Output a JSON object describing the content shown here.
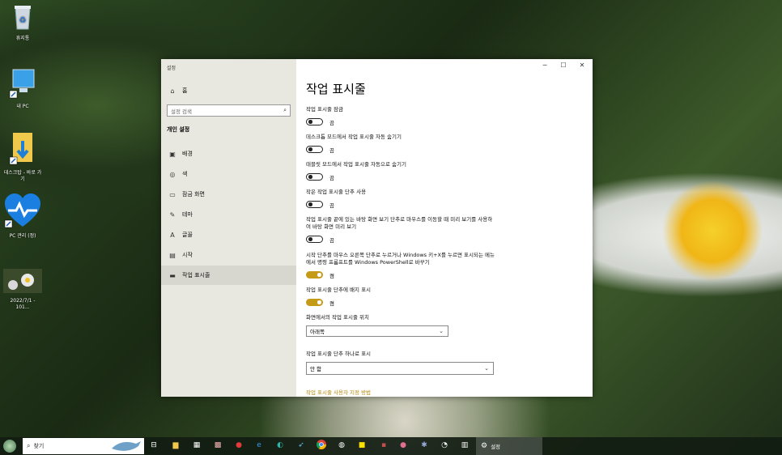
{
  "desktop": {
    "icons": [
      {
        "label": "휴지통",
        "icon": "recycle-bin-icon"
      },
      {
        "label": "내 PC",
        "icon": "computer-icon"
      },
      {
        "label": "데스크탑 - 바로 가기",
        "icon": "download-folder-icon"
      },
      {
        "label": "PC 관리 (정)",
        "icon": "heart-health-icon"
      },
      {
        "label": "2022/7/1 - 101...",
        "icon": "image-thumbnail-icon"
      }
    ]
  },
  "window": {
    "app_title": "설정",
    "controls": {
      "minimize": "─",
      "maximize": "☐",
      "close": "✕"
    }
  },
  "sidebar": {
    "home": {
      "label": "홈",
      "icon": "home-icon"
    },
    "search_placeholder": "설정 검색",
    "section_title": "개인 설정",
    "items": [
      {
        "label": "배경",
        "icon": "image-icon"
      },
      {
        "label": "색",
        "icon": "palette-icon"
      },
      {
        "label": "잠금 화면",
        "icon": "lock-screen-icon"
      },
      {
        "label": "테마",
        "icon": "theme-brush-icon"
      },
      {
        "label": "글꼴",
        "icon": "font-icon"
      },
      {
        "label": "시작",
        "icon": "start-icon"
      },
      {
        "label": "작업 표시줄",
        "icon": "taskbar-icon"
      }
    ],
    "active_index": 6
  },
  "main": {
    "title": "작업 표시줄",
    "settings": [
      {
        "label": "작업 표시줄 잠금",
        "state": "끔",
        "on": false
      },
      {
        "label": "데스크톱 모드에서 작업 표시줄 자동 숨기기",
        "state": "끔",
        "on": false
      },
      {
        "label": "태블릿 모드에서 작업 표시줄 자동으로 숨기기",
        "state": "끔",
        "on": false
      },
      {
        "label": "작은 작업 표시줄 단추 사용",
        "state": "끔",
        "on": false
      },
      {
        "label": "작업 표시줄 끝에 있는 바탕 화면 보기 단추로 마우스를 이동할 때 미리 보기를 사용하여 바탕 화면 미리 보기",
        "state": "끔",
        "on": false
      },
      {
        "label": "시작 단추를 마우스 오른쪽 단추로 누르거나 Windows 키+X를 누르면 표시되는 메뉴에서 명령 프롬프트를 Windows PowerShell로 바꾸기",
        "state": "켬",
        "on": true
      },
      {
        "label": "작업 표시줄 단추에 배지 표시",
        "state": "켬",
        "on": true
      }
    ],
    "location": {
      "label": "화면에서의 작업 표시줄 위치",
      "value": "아래쪽"
    },
    "combine": {
      "label": "작업 표시줄 단추 하나로 표시",
      "value": "안 함"
    },
    "link": "작업 표시줄 사용자 지정 방법"
  },
  "taskbar": {
    "search_placeholder": "찾기",
    "active_app": "설정",
    "pinned": [
      "task-view-icon",
      "file-explorer-icon",
      "calendar-icon",
      "photo-app-icon",
      "red-app-icon",
      "edge-legacy-icon",
      "edge-icon",
      "bird-app-icon",
      "chrome-icon",
      "capture-app-icon",
      "kakaotalk-icon",
      "pink-app-icon",
      "gear-app-icon",
      "tool-icon",
      "print-icon"
    ]
  }
}
